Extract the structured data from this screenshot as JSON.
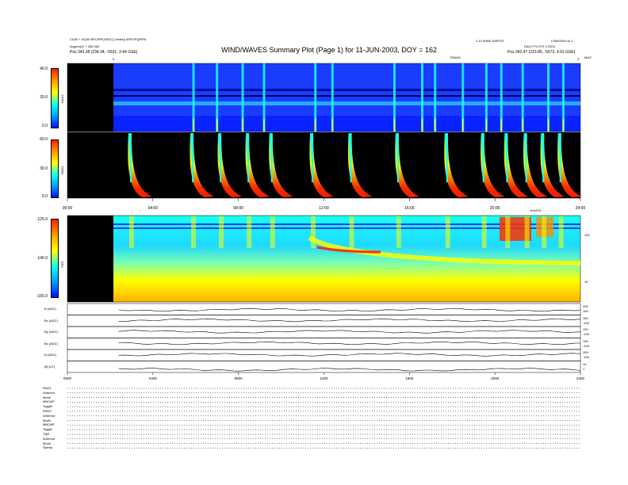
{
  "header": {
    "left_line1": "CD30 + DQ30 BPC/RP(DSDC) (Yearly) AFEOFQ/RPA",
    "left_line2": "Argyrius/2 + 180.06C",
    "left_line3": "Pos    343.38 (234.34, -5531, 3.44 GSE)",
    "title": "WIND/WAVES Summary Plot (Page 1) for 11-JUN-2003, DOY = 162",
    "right_line1a": "1.10 WIND SWPOS",
    "right_line1b": "LSM/ODM v6.1",
    "right_line2": "DAILY PLOTS 3 2003",
    "right_line3": "Pos    342.47 (223.85, -5573, 4.91 GSE)",
    "rad2_freq_label": "TEMHZ",
    "rad2_corner_label": "MHZ",
    "tnr_corner_label": "kHz/HZ",
    "rad2_left_tick": "0",
    "rad2_right_tick": "0"
  },
  "colors": {
    "black": "#000000",
    "background_blue": "#1a3cff",
    "colorbar": [
      "#ff1f00",
      "#ff9a00",
      "#ffff00",
      "#19ffef",
      "#00a0ff",
      "#0010ff"
    ]
  },
  "chart_data": [
    {
      "type": "heatmap",
      "panel": "RAD2",
      "ylabel": "RAD2",
      "colorbar_ticks": [
        "40.0",
        "20.0",
        "0.0"
      ],
      "colorbar_range": [
        0,
        40
      ],
      "xlim": [
        0,
        24
      ],
      "data_gap_hours": [
        0,
        2.4
      ],
      "burst_times_hours": [
        5.9,
        7.0,
        8.2,
        9.2,
        11.6,
        12.4,
        15.3,
        16.6,
        17.2,
        18.5,
        19.6,
        20.3,
        21.3,
        22.5,
        23.2
      ]
    },
    {
      "type": "heatmap",
      "panel": "RAD1",
      "ylabel": "RAD1",
      "colorbar_ticks": [
        "60.0",
        "30.0",
        "0.0"
      ],
      "colorbar_range": [
        0,
        60
      ],
      "x_tick_labels": [
        "00:00",
        "04:00",
        "08:00",
        "12:00",
        "16:00",
        "20:00",
        "24:00"
      ],
      "xlim": [
        0,
        24
      ],
      "data_gap_hours": [
        0,
        2.4
      ],
      "burst_times_hours": [
        3.0,
        5.9,
        7.2,
        8.5,
        9.6,
        11.5,
        13.3,
        15.5,
        17.8,
        19.5,
        20.6,
        21.5,
        22.3,
        23.1
      ]
    },
    {
      "type": "heatmap",
      "panel": "TNR",
      "ylabel": "TNR",
      "colorbar_ticks": [
        "-125.0",
        "-140.0",
        "-155.0"
      ],
      "colorbar_range": [
        -155,
        -125
      ],
      "right_axis_ticks": [
        "100",
        "10"
      ],
      "xlim": [
        0,
        24
      ],
      "data_gap_hours": [
        0,
        2.4
      ]
    },
    {
      "type": "line",
      "panel": "magnetic field",
      "rows": [
        {
          "label": "B (ADC)",
          "right_ticks": [
            "200",
            "100"
          ]
        },
        {
          "label": "Bx (ADC)",
          "right_ticks": [
            "100",
            "-100"
          ]
        },
        {
          "label": "By (ADC)",
          "right_ticks": [
            "100",
            "-100"
          ]
        },
        {
          "label": "Bz (ADC)",
          "right_ticks": [
            "100",
            "-100"
          ]
        },
        {
          "label": "N (ADC)",
          "right_ticks": [
            "100",
            "-100"
          ]
        },
        {
          "label": "|B| (nT)",
          "right_ticks": [
            "10",
            "1"
          ]
        }
      ],
      "x_tick_labels": [
        "0000",
        "0400",
        "0800",
        "1200",
        "1600",
        "2000",
        "2400"
      ],
      "xlim": [
        0,
        24
      ]
    }
  ],
  "status_labels": [
    "RAD1",
    "Antenna",
    "Mode",
    "MNOAP",
    "Toggle",
    "RAD2",
    "Antenna",
    "Mode",
    "MNOAP",
    "Toggle",
    "TNR",
    "Antenna",
    "Mode",
    "Sweep"
  ]
}
